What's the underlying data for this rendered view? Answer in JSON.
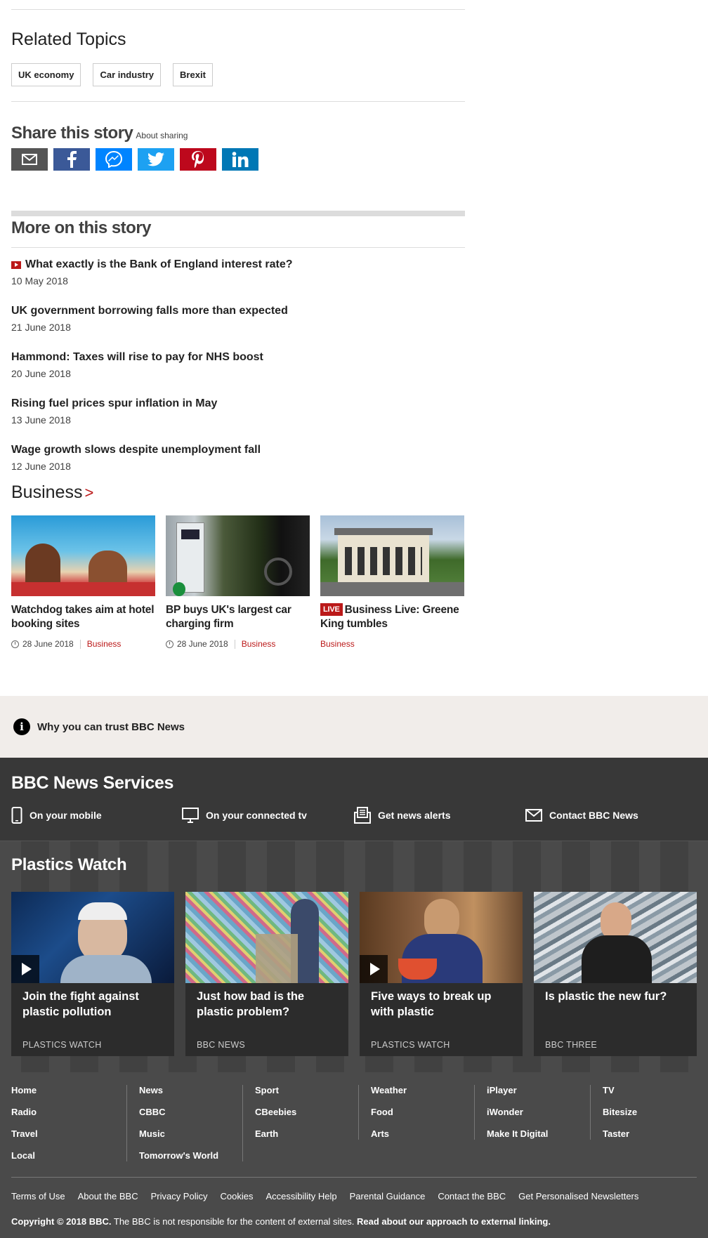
{
  "related": {
    "title": "Related Topics",
    "tags": [
      "UK economy",
      "Car industry",
      "Brexit"
    ]
  },
  "share": {
    "title": "Share this story",
    "about": "About sharing",
    "buttons": [
      {
        "name": "email",
        "icon": "email-icon",
        "color": "#555555"
      },
      {
        "name": "facebook",
        "icon": "facebook-icon",
        "color": "#3b5998"
      },
      {
        "name": "messenger",
        "icon": "messenger-icon",
        "color": "#0084ff"
      },
      {
        "name": "twitter",
        "icon": "twitter-icon",
        "color": "#1da1f2"
      },
      {
        "name": "pinterest",
        "icon": "pinterest-icon",
        "color": "#bd081c"
      },
      {
        "name": "linkedin",
        "icon": "linkedin-icon",
        "color": "#0077b5"
      }
    ]
  },
  "more": {
    "title": "More on this story",
    "stories": [
      {
        "title": "What exactly is the Bank of England interest rate?",
        "date": "10 May 2018",
        "video": true
      },
      {
        "title": "UK government borrowing falls more than expected",
        "date": "21 June 2018",
        "video": false
      },
      {
        "title": "Hammond: Taxes will rise to pay for NHS boost",
        "date": "20 June 2018",
        "video": false
      },
      {
        "title": "Rising fuel prices spur inflation in May",
        "date": "13 June 2018",
        "video": false
      },
      {
        "title": "Wage growth slows despite unemployment fall",
        "date": "12 June 2018",
        "video": false
      }
    ]
  },
  "business": {
    "title": "Business",
    "chevron": ">",
    "cards": [
      {
        "title": "Watchdog takes aim at hotel booking sites",
        "date": "28 June 2018",
        "section": "Business",
        "live": false
      },
      {
        "title": "BP buys UK's largest car charging firm",
        "date": "28 June 2018",
        "section": "Business",
        "live": false
      },
      {
        "title": "Business Live: Greene King tumbles",
        "live_label": "LIVE",
        "section": "Business",
        "live": true
      }
    ]
  },
  "trust": {
    "text": "Why you can trust BBC News"
  },
  "services": {
    "title": "BBC News Services",
    "items": [
      {
        "label": "On your mobile",
        "icon": "mobile-icon"
      },
      {
        "label": "On your connected tv",
        "icon": "tv-icon"
      },
      {
        "label": "Get news alerts",
        "icon": "alerts-icon"
      },
      {
        "label": "Contact BBC News",
        "icon": "envelope-icon"
      }
    ]
  },
  "plastics": {
    "title": "Plastics Watch",
    "cards": [
      {
        "title": "Join the fight against plastic pollution",
        "source": "PLASTICS WATCH",
        "video": true
      },
      {
        "title": "Just how bad is the plastic problem?",
        "source": "BBC NEWS",
        "video": false
      },
      {
        "title": "Five ways to break up with plastic",
        "source": "PLASTICS WATCH",
        "video": true
      },
      {
        "title": "Is plastic the new fur?",
        "source": "BBC THREE",
        "video": false
      }
    ]
  },
  "footer": {
    "columns": [
      [
        "Home",
        "Radio",
        "Travel",
        "Local"
      ],
      [
        "News",
        "CBBC",
        "Music",
        "Tomorrow's World"
      ],
      [
        "Sport",
        "CBeebies",
        "Earth"
      ],
      [
        "Weather",
        "Food",
        "Arts"
      ],
      [
        "iPlayer",
        "iWonder",
        "Make It Digital"
      ],
      [
        "TV",
        "Bitesize",
        "Taster"
      ]
    ],
    "legal": [
      "Terms of Use",
      "About the BBC",
      "Privacy Policy",
      "Cookies",
      "Accessibility Help",
      "Parental Guidance",
      "Contact the BBC",
      "Get Personalised Newsletters"
    ],
    "copyright_bold": "Copyright © 2018 BBC.",
    "copyright_text": " The BBC is not responsible for the content of external sites. ",
    "copyright_link": "Read about our approach to external linking."
  }
}
